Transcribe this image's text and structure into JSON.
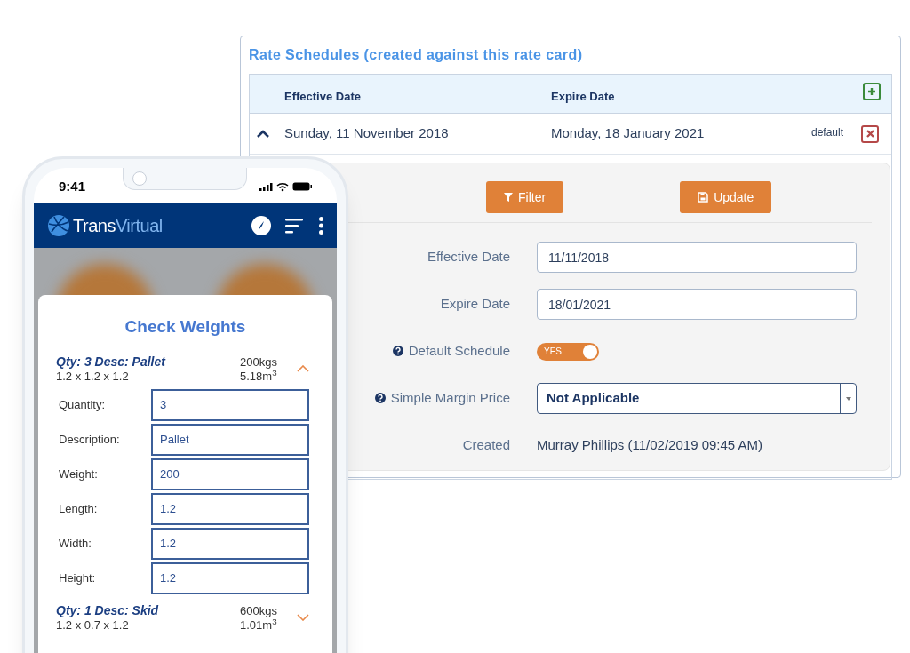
{
  "panel": {
    "title": "Rate Schedules (created against this rate card)",
    "table": {
      "columns": [
        "Effective Date",
        "Expire Date"
      ],
      "rows": [
        {
          "effective": "Sunday, 11 November 2018",
          "expire": "Monday, 18 January 2021",
          "tag": "default",
          "expanded": true
        }
      ]
    },
    "buttons": [
      {
        "label": "Filter",
        "kind": "filter"
      },
      {
        "label": "Update",
        "kind": "save"
      }
    ],
    "fields": [
      {
        "kind": "text",
        "label": "Effective Date",
        "value": "11/11/2018"
      },
      {
        "kind": "text",
        "label": "Expire Date",
        "value": "18/01/2021"
      },
      {
        "kind": "toggle",
        "label": "Default Schedule",
        "help": true,
        "on": true,
        "value": "YES"
      },
      {
        "kind": "select",
        "label": "Simple Margin Price",
        "help": true,
        "value": "Not Applicable"
      },
      {
        "kind": "static",
        "label": "Created",
        "value": "Murray Phillips (11/02/2019 09:45 AM)"
      }
    ]
  },
  "phone": {
    "time": "9:41",
    "brand": [
      "Trans",
      "Virtual"
    ],
    "dialog": {
      "title": "Check Weights",
      "items": [
        {
          "heading": "Qty: 3 Desc: Pallet",
          "dims": "1.2 x 1.2 x 1.2",
          "weight": "200kgs",
          "volume": "5.18m$^{3}$",
          "expanded": true,
          "fields": [
            {
              "label": "Quantity:",
              "value": "3"
            },
            {
              "label": "Description:",
              "value": "Pallet"
            },
            {
              "label": "Weight:",
              "value": "200"
            },
            {
              "label": "Length:",
              "value": "1.2"
            },
            {
              "label": "Width:",
              "value": "1.2"
            },
            {
              "label": "Height:",
              "value": "1.2"
            }
          ]
        },
        {
          "heading": "Qty: 1 Desc: Skid",
          "dims": "1.2 x 0.7 x 1.2",
          "weight": "600kgs",
          "volume": "1.01m$^{3}$",
          "expanded": false
        }
      ]
    }
  }
}
